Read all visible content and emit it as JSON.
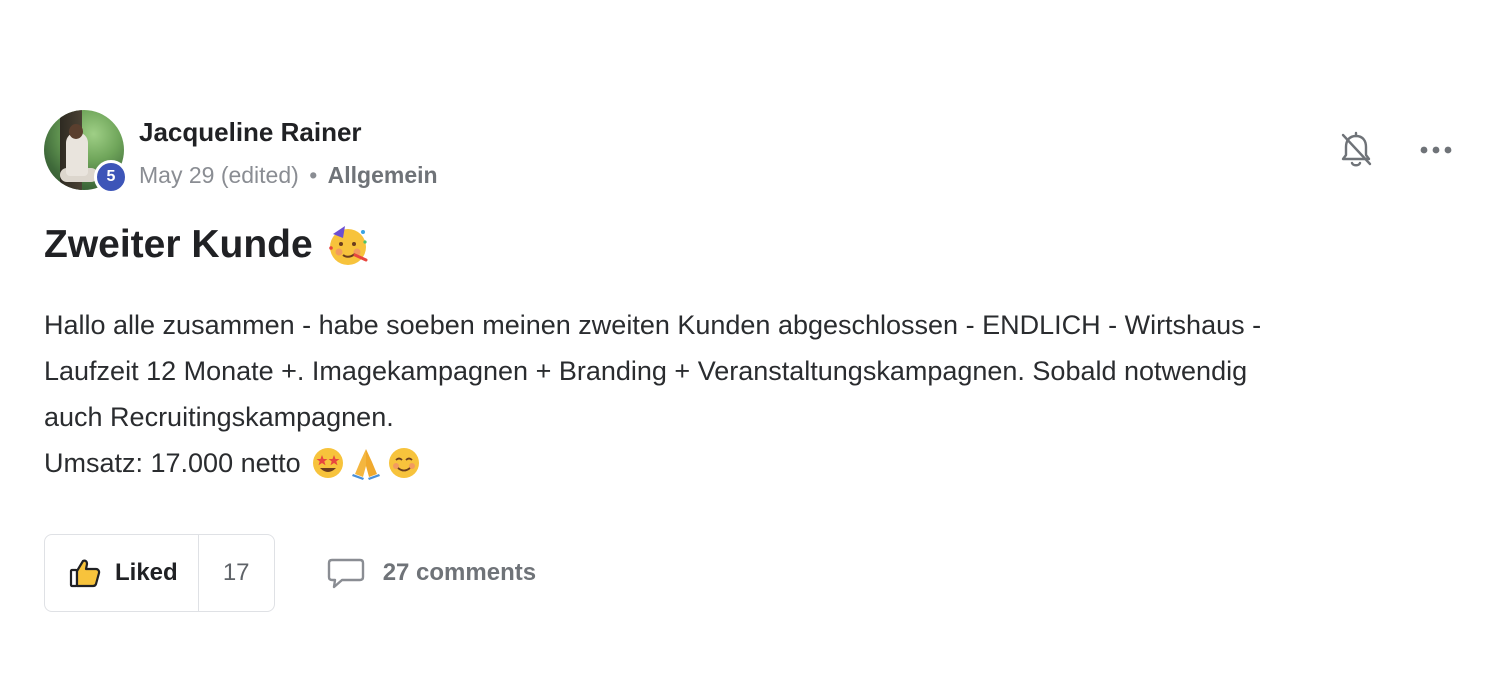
{
  "post": {
    "author": {
      "name": "Jacqueline Rainer",
      "level": "5",
      "avatar_icon": "user-avatar-photo"
    },
    "meta": {
      "date": "May 29 (edited)",
      "separator": "•",
      "category": "Allgemein"
    },
    "title": "Zweiter Kunde",
    "title_emoji": "🥳",
    "body": {
      "line1": "Hallo alle zusammen - habe soeben meinen zweiten Kunden abgeschlossen - ENDLICH - Wirtshaus -",
      "line2": "Laufzeit 12 Monate +. Imagekampagnen + Branding + Veranstaltungskampagnen. Sobald notwendig",
      "line3": "auch Recruitingskampagnen.",
      "line4": "Umsatz: 17.000 netto",
      "line4_emojis": [
        "🤩",
        "🙏",
        "☺️"
      ]
    },
    "actions": {
      "like_label": "Liked",
      "like_count": "17",
      "comments_label": "27 comments"
    },
    "icons": {
      "bell": "bell-off-icon",
      "more": "more-horizontal-icon",
      "like": "thumbs-up-icon",
      "comment": "comment-icon"
    },
    "colors": {
      "level_badge": "#3d55b8",
      "border": "#dfe1e5",
      "meta_text": "#8a8d93"
    }
  }
}
